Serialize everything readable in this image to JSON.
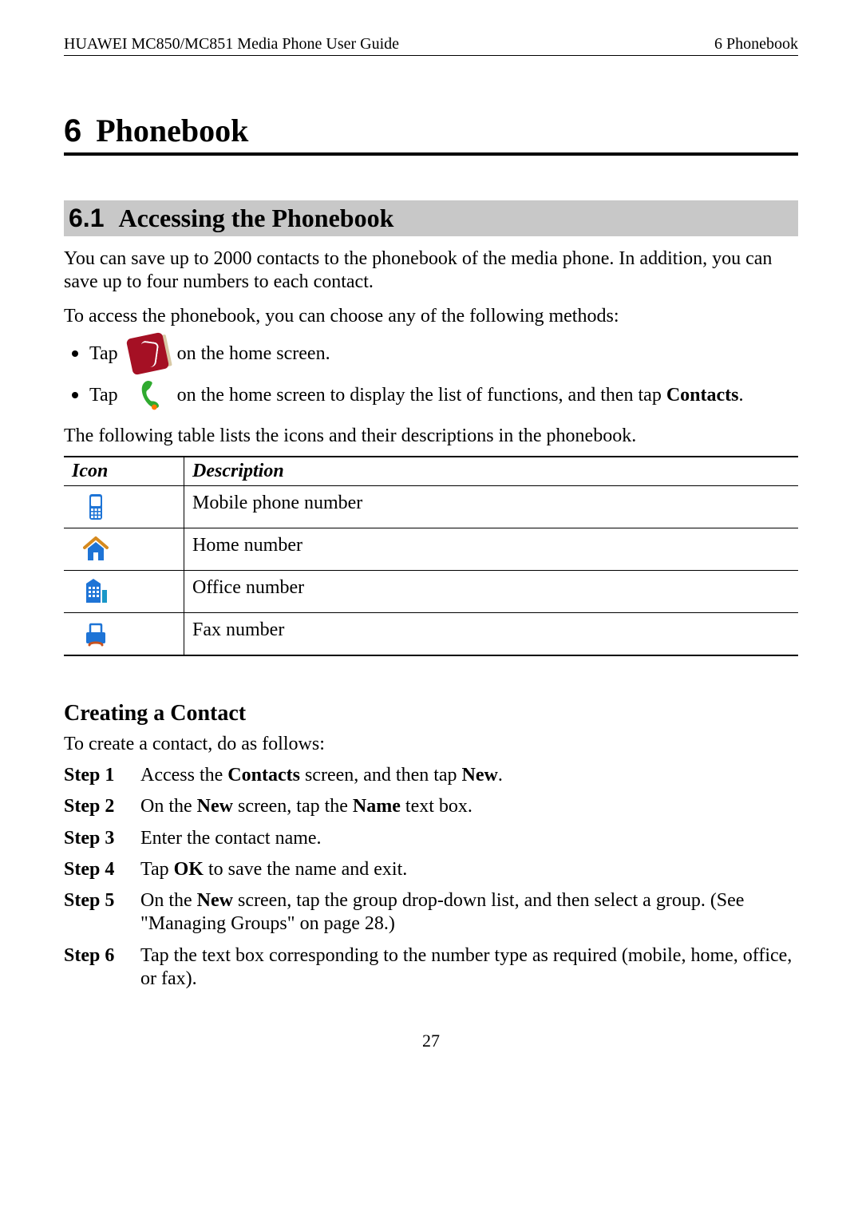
{
  "header": {
    "left": "HUAWEI MC850/MC851 Media Phone User Guide",
    "right": "6 Phonebook"
  },
  "h1": {
    "num": "6",
    "text": "Phonebook"
  },
  "h2": {
    "num": "6.1",
    "text": "Accessing the Phonebook"
  },
  "p1": "You can save up to 2000 contacts to the phonebook of the media phone. In addition, you can save up to four numbers to each contact.",
  "p2": "To access the phonebook, you can choose any of the following methods:",
  "methods": {
    "m1_pre": "Tap",
    "m1_post": "on the home screen.",
    "m2_pre": "Tap",
    "m2_mid": "on the home screen to display the list of functions, and then tap ",
    "m2_bold": "Contacts",
    "m2_end": "."
  },
  "p3": "The following table lists the icons and their descriptions in the phonebook.",
  "table": {
    "h_icon": "Icon",
    "h_desc": "Description",
    "rows": [
      {
        "icon_name": "mobile-icon",
        "desc": "Mobile phone number"
      },
      {
        "icon_name": "home-icon",
        "desc": "Home number"
      },
      {
        "icon_name": "office-icon",
        "desc": "Office number"
      },
      {
        "icon_name": "fax-icon",
        "desc": "Fax number"
      }
    ]
  },
  "h3": "Creating a Contact",
  "p4": "To create a contact, do as follows:",
  "steps": [
    {
      "label": "Step 1",
      "parts": [
        "Access the ",
        [
          "b",
          "Contacts"
        ],
        " screen, and then tap ",
        [
          "b",
          "New"
        ],
        "."
      ]
    },
    {
      "label": "Step 2",
      "parts": [
        "On the ",
        [
          "b",
          "New"
        ],
        " screen, tap the ",
        [
          "b",
          "Name"
        ],
        " text box."
      ]
    },
    {
      "label": "Step 3",
      "parts": [
        "Enter the contact name."
      ]
    },
    {
      "label": "Step 4",
      "parts": [
        "Tap ",
        [
          "b",
          "OK"
        ],
        " to save the name and exit."
      ]
    },
    {
      "label": "Step 5",
      "parts": [
        "On the ",
        [
          "b",
          "New"
        ],
        " screen, tap the group drop-down list, and then select a group. (See \"Managing Groups\" on page 28.)"
      ]
    },
    {
      "label": "Step 6",
      "parts": [
        "Tap the text box corresponding to the number type as required (mobile, home, office, or fax)."
      ]
    }
  ],
  "page_num": "27"
}
